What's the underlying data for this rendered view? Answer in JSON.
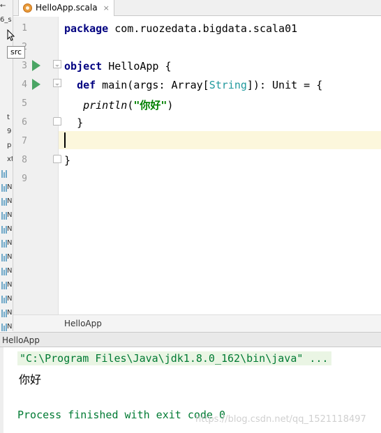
{
  "tab": {
    "label": "HelloApp.scala",
    "close": "×"
  },
  "tooltip": "src",
  "project_strip": [
    {
      "text": "←"
    },
    {
      "text": "6_s"
    },
    {
      "text": ""
    },
    {
      "text": ""
    },
    {
      "text": ""
    },
    {
      "text": ""
    },
    {
      "text": ""
    },
    {
      "text": ""
    },
    {
      "text": "t"
    },
    {
      "text": "9"
    },
    {
      "text": "p"
    },
    {
      "text": "xte"
    },
    {
      "text": ""
    },
    {
      "text": "N"
    },
    {
      "text": "N"
    },
    {
      "text": "N"
    },
    {
      "text": "N"
    },
    {
      "text": "N"
    },
    {
      "text": "N"
    },
    {
      "text": "N"
    },
    {
      "text": "N"
    },
    {
      "text": "N"
    },
    {
      "text": "N"
    },
    {
      "text": "N"
    }
  ],
  "editor": {
    "line_numbers": [
      "1",
      "2",
      "3",
      "4",
      "5",
      "6",
      "7",
      "8",
      "9"
    ],
    "line1": {
      "kw": "package",
      "rest": " com.ruozedata.bigdata.scala01"
    },
    "line3": {
      "kw": "object",
      "rest": " HelloApp {"
    },
    "line4": {
      "kw": "def",
      "a": " main(args: Array[",
      "type": "String",
      "b": "]): Unit = {"
    },
    "line5": {
      "fn": "println",
      "open": "(",
      "str": "\"你好\"",
      "close": ")"
    },
    "line6": "}",
    "line8": "}"
  },
  "breadcrumb": "HelloApp",
  "run_panel": {
    "title": "HelloApp",
    "command": "\"C:\\Program Files\\Java\\jdk1.8.0_162\\bin\\java\" ...",
    "output": "你好",
    "exit": "Process finished with exit code 0",
    "watermark": "https://blog.csdn.net/qq_1521118497"
  }
}
